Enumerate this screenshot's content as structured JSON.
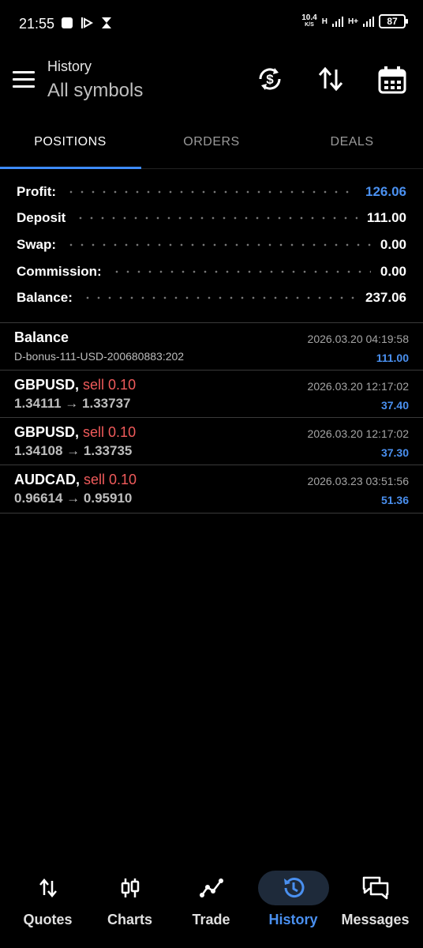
{
  "status_bar": {
    "time": "21:55",
    "speed_value": "10.4",
    "speed_unit": "K/S",
    "net1": "H",
    "net2": "H+",
    "battery": "87"
  },
  "appbar": {
    "title": "History",
    "subtitle": "All symbols",
    "icons": [
      "currency-sync-icon",
      "sort-icon",
      "calendar-icon"
    ]
  },
  "tabs": [
    {
      "label": "POSITIONS",
      "active": true
    },
    {
      "label": "ORDERS",
      "active": false
    },
    {
      "label": "DEALS",
      "active": false
    }
  ],
  "summary": [
    {
      "label": "Profit:",
      "value": "126.06",
      "color": "#4a90f0"
    },
    {
      "label": "Deposit",
      "value": "111.00"
    },
    {
      "label": "Swap:",
      "value": "0.00"
    },
    {
      "label": "Commission:",
      "value": "0.00"
    },
    {
      "label": "Balance:",
      "value": "237.06"
    }
  ],
  "rows": [
    {
      "symbol": "Balance",
      "direction": "",
      "sub": "D-bonus-111-USD-200680883:202",
      "date": "2026.03.20 04:19:58",
      "value": "111.00"
    },
    {
      "symbol": "GBPUSD,",
      "direction": "sell 0.10",
      "sub": "1.34111 → 1.33737",
      "date": "2026.03.20 12:17:02",
      "value": "37.40"
    },
    {
      "symbol": "GBPUSD,",
      "direction": "sell 0.10",
      "sub": "1.34108 → 1.33735",
      "date": "2026.03.20 12:17:02",
      "value": "37.30"
    },
    {
      "symbol": "AUDCAD,",
      "direction": "sell 0.10",
      "sub": "0.96614 → 0.95910",
      "date": "2026.03.23 03:51:56",
      "value": "51.36"
    }
  ],
  "bottom_nav": [
    {
      "label": "Quotes",
      "icon": "quotes-arrows-icon",
      "active": false
    },
    {
      "label": "Charts",
      "icon": "candlestick-icon",
      "active": false
    },
    {
      "label": "Trade",
      "icon": "trend-line-icon",
      "active": false
    },
    {
      "label": "History",
      "icon": "history-clock-icon",
      "active": true
    },
    {
      "label": "Messages",
      "icon": "messages-icon",
      "active": false
    }
  ],
  "colors": {
    "accent": "#4a90f0",
    "sell": "#f05b5b",
    "background": "#000000"
  }
}
